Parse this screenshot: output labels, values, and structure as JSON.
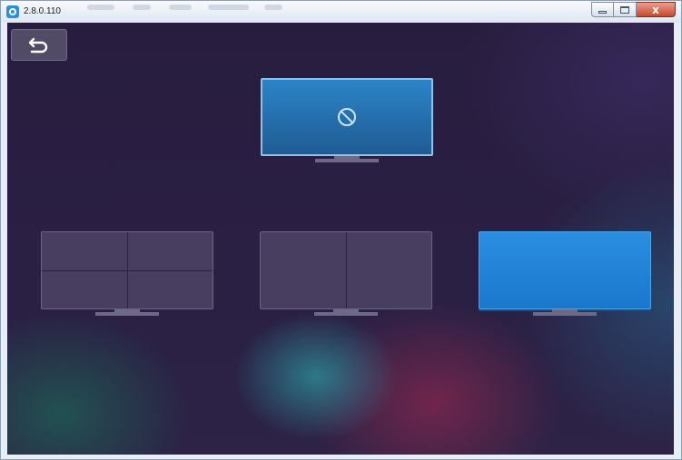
{
  "window": {
    "title": "2.8.0.110",
    "close_glyph": "x",
    "colors": {
      "background": "#261d3d",
      "selected_screen": "#1a78cc",
      "blank_screen": "#1f5c93"
    }
  },
  "toolbar": {
    "back_icon": "undo-arrow-icon"
  },
  "monitors": {
    "top": {
      "layout": "blank",
      "icon": "no-signal-icon"
    },
    "bottom": [
      {
        "layout": "quad-split",
        "selected": false
      },
      {
        "layout": "dual-split",
        "selected": false
      },
      {
        "layout": "single",
        "selected": true
      }
    ]
  }
}
